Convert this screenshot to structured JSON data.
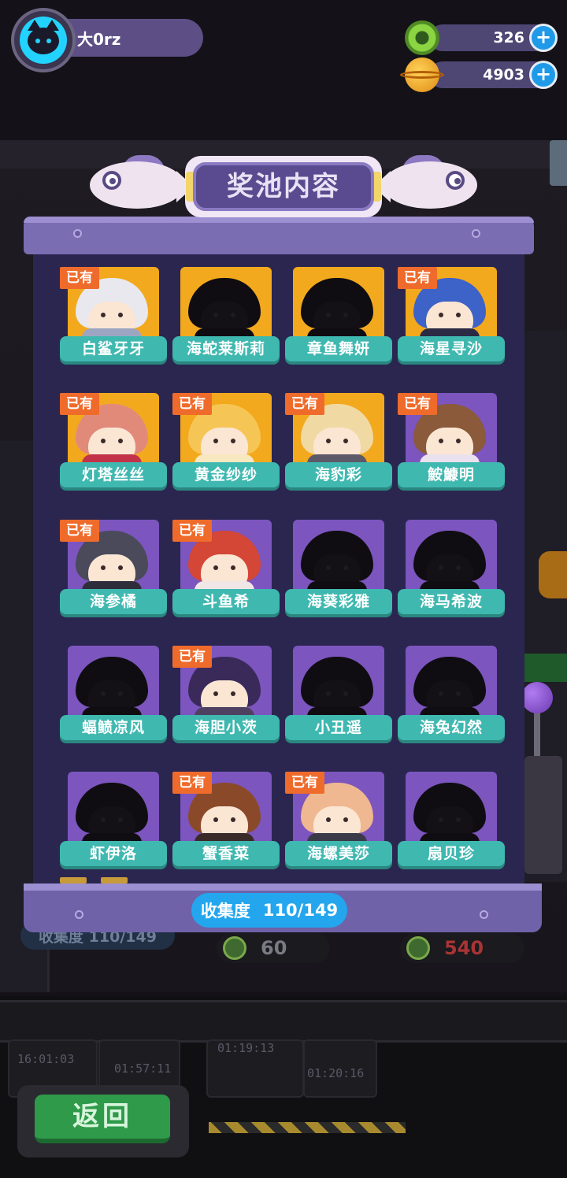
{
  "player": {
    "name": "大0rz"
  },
  "resources": {
    "gems": {
      "icon": "green-donut-icon",
      "value": "326"
    },
    "coins": {
      "icon": "planet-coin-icon",
      "value": "4903"
    }
  },
  "modal": {
    "title": "奖池内容",
    "collection_label": "收集度",
    "collection_value": "110/149"
  },
  "owned_badge": "已有",
  "cards": [
    {
      "name": "白鲨牙牙",
      "owned": true,
      "bg": "gold",
      "hair": "#e8e8ee",
      "accent": "#9ca6c2"
    },
    {
      "name": "海蛇莱斯莉",
      "owned": false,
      "bg": "gold",
      "hair": "#0f0d12",
      "accent": "#0f0d12"
    },
    {
      "name": "章鱼舞妍",
      "owned": false,
      "bg": "gold",
      "hair": "#0f0d12",
      "accent": "#0f0d12"
    },
    {
      "name": "海星寻沙",
      "owned": true,
      "bg": "gold",
      "hair": "#3d62c8",
      "accent": "#2b2b45"
    },
    {
      "name": "灯塔丝丝",
      "owned": true,
      "bg": "gold",
      "hair": "#e28a7a",
      "accent": "#c2334a"
    },
    {
      "name": "黄金纱纱",
      "owned": true,
      "bg": "gold",
      "hair": "#f5c656",
      "accent": "#f8e8c0"
    },
    {
      "name": "海豹彩",
      "owned": true,
      "bg": "gold",
      "hair": "#f1d9a3",
      "accent": "#5c5a68"
    },
    {
      "name": "鮟鱇明",
      "owned": true,
      "bg": "purple",
      "hair": "#8a5a3a",
      "accent": "#e9e2ee"
    },
    {
      "name": "海参橘",
      "owned": true,
      "bg": "purple",
      "hair": "#4a4a5a",
      "accent": "#2e2e3a"
    },
    {
      "name": "斗鱼希",
      "owned": true,
      "bg": "purple",
      "hair": "#d44636",
      "accent": "#f0e6e6"
    },
    {
      "name": "海葵彩雅",
      "owned": false,
      "bg": "purple",
      "hair": "#0f0d12",
      "accent": "#0f0d12"
    },
    {
      "name": "海马希波",
      "owned": false,
      "bg": "purple",
      "hair": "#0f0d12",
      "accent": "#0f0d12"
    },
    {
      "name": "蝠鲼凉风",
      "owned": false,
      "bg": "purple",
      "hair": "#0f0d12",
      "accent": "#0f0d12"
    },
    {
      "name": "海胆小茨",
      "owned": true,
      "bg": "purple",
      "hair": "#3a2a5a",
      "accent": "#4e4060"
    },
    {
      "name": "小丑遥",
      "owned": false,
      "bg": "purple",
      "hair": "#0f0d12",
      "accent": "#0f0d12"
    },
    {
      "name": "海兔幻然",
      "owned": false,
      "bg": "purple",
      "hair": "#0f0d12",
      "accent": "#0f0d12"
    },
    {
      "name": "虾伊洛",
      "owned": false,
      "bg": "purple",
      "hair": "#0f0d12",
      "accent": "#0f0d12"
    },
    {
      "name": "蟹香菜",
      "owned": true,
      "bg": "purple",
      "hair": "#8a4a2a",
      "accent": "#3a2a2a"
    },
    {
      "name": "海螺美莎",
      "owned": true,
      "bg": "purple",
      "hair": "#f0b890",
      "accent": "#3a3a48"
    },
    {
      "name": "扇贝珍",
      "owned": false,
      "bg": "purple",
      "hair": "#0f0d12",
      "accent": "#0f0d12"
    }
  ],
  "background": {
    "counter_left": "60",
    "counter_right": "540",
    "counter_collect": "收集度 110/149",
    "timers": [
      "16:01:03",
      "01:19:13",
      "01:57:11",
      "01:20:16"
    ]
  },
  "back_button": "返回"
}
